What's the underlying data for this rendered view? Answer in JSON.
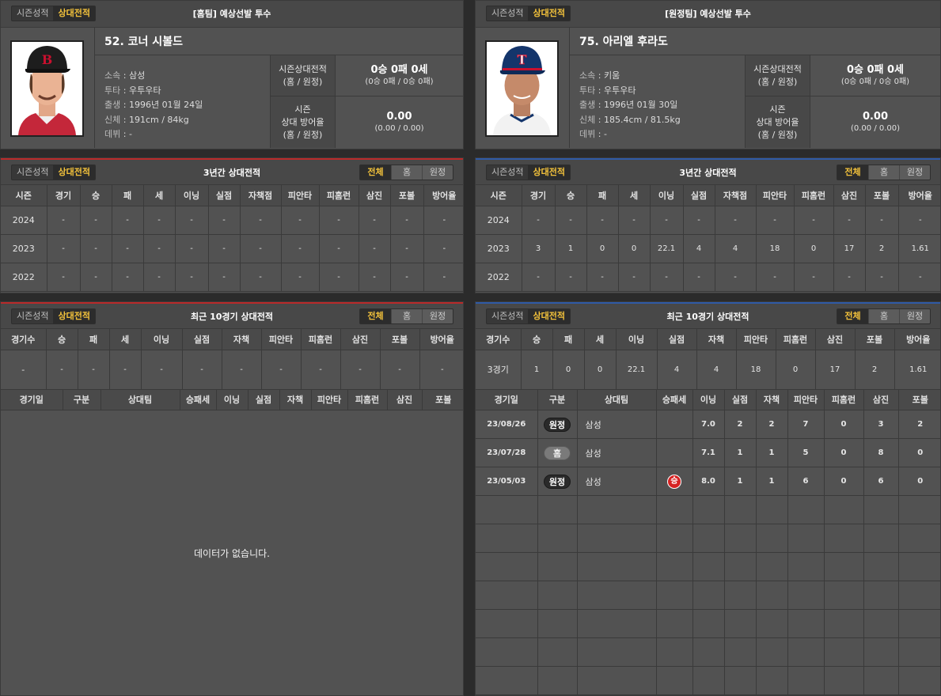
{
  "tabs": {
    "season": "시즌성적",
    "versus": "상대전적"
  },
  "seg": {
    "all": "전체",
    "home": "홈",
    "away": "원정"
  },
  "home": {
    "header": "[홈팀] 예상선발 투수",
    "player": {
      "name": "52. 코너 시볼드",
      "team_label": "소속",
      "team": "삼성",
      "throw_label": "투타",
      "throw": "우투우타",
      "birth_label": "출생",
      "birth": "1996년 01월 24일",
      "body_label": "신체",
      "body": "191cm / 84kg",
      "debut_label": "데뷔",
      "debut": "-",
      "cap_logo": "B",
      "cap_color": "#1d1d1d",
      "logo_color": "#c8102e"
    },
    "versus_label": "시즌상대전적",
    "versus_sub": "(홈 / 원정)",
    "versus_value": "0승 0패 0세",
    "versus_detail": "(0승 0패 / 0승 0패)",
    "era_label1": "시즌",
    "era_label2": "상대 방어율",
    "era_sub": "(홈 / 원정)",
    "era_value": "0.00",
    "era_detail": "(0.00 / 0.00)",
    "three_year": {
      "title": "3년간 상대전적",
      "columns": [
        "시즌",
        "경기",
        "승",
        "패",
        "세",
        "이닝",
        "실점",
        "자책점",
        "피안타",
        "피홈런",
        "삼진",
        "포볼",
        "방어율"
      ],
      "rows": [
        [
          "2024",
          "-",
          "-",
          "-",
          "-",
          "-",
          "-",
          "-",
          "-",
          "-",
          "-",
          "-",
          "-"
        ],
        [
          "2023",
          "-",
          "-",
          "-",
          "-",
          "-",
          "-",
          "-",
          "-",
          "-",
          "-",
          "-",
          "-"
        ],
        [
          "2022",
          "-",
          "-",
          "-",
          "-",
          "-",
          "-",
          "-",
          "-",
          "-",
          "-",
          "-",
          "-"
        ]
      ]
    },
    "recent": {
      "title": "최근 10경기 상대전적",
      "sum_columns": [
        "경기수",
        "승",
        "패",
        "세",
        "이닝",
        "실점",
        "자책",
        "피안타",
        "피홈런",
        "삼진",
        "포볼",
        "방어율"
      ],
      "sum_row": [
        "-",
        "-",
        "-",
        "-",
        "-",
        "-",
        "-",
        "-",
        "-",
        "-",
        "-",
        "-"
      ],
      "game_columns": [
        "경기일",
        "구분",
        "상대팀",
        "승패세",
        "이닝",
        "실점",
        "자책",
        "피안타",
        "피홈런",
        "삼진",
        "포볼"
      ],
      "empty": "데이터가 없습니다."
    }
  },
  "away": {
    "header": "[원정팀] 예상선발 투수",
    "player": {
      "name": "75. 아리엘 후라도",
      "team_label": "소속",
      "team": "키움",
      "throw_label": "투타",
      "throw": "우투우타",
      "birth_label": "출생",
      "birth": "1996년 01월 30일",
      "body_label": "신체",
      "body": "185.4cm / 81.5kg",
      "debut_label": "데뷔",
      "debut": "-",
      "cap_logo": "T",
      "cap_color": "#14356b",
      "logo_color": "#c8102e"
    },
    "versus_label": "시즌상대전적",
    "versus_sub": "(홈 / 원정)",
    "versus_value": "0승 0패 0세",
    "versus_detail": "(0승 0패 / 0승 0패)",
    "era_label1": "시즌",
    "era_label2": "상대 방어율",
    "era_sub": "(홈 / 원정)",
    "era_value": "0.00",
    "era_detail": "(0.00 / 0.00)",
    "three_year": {
      "title": "3년간 상대전적",
      "columns": [
        "시즌",
        "경기",
        "승",
        "패",
        "세",
        "이닝",
        "실점",
        "자책점",
        "피안타",
        "피홈런",
        "삼진",
        "포볼",
        "방어율"
      ],
      "rows": [
        [
          "2024",
          "-",
          "-",
          "-",
          "-",
          "-",
          "-",
          "-",
          "-",
          "-",
          "-",
          "-",
          "-"
        ],
        [
          "2023",
          "3",
          "1",
          "0",
          "0",
          "22.1",
          "4",
          "4",
          "18",
          "0",
          "17",
          "2",
          "1.61"
        ],
        [
          "2022",
          "-",
          "-",
          "-",
          "-",
          "-",
          "-",
          "-",
          "-",
          "-",
          "-",
          "-",
          "-"
        ]
      ]
    },
    "recent": {
      "title": "최근 10경기 상대전적",
      "sum_columns": [
        "경기수",
        "승",
        "패",
        "세",
        "이닝",
        "실점",
        "자책",
        "피안타",
        "피홈런",
        "삼진",
        "포볼",
        "방어율"
      ],
      "sum_row": [
        "3경기",
        "1",
        "0",
        "0",
        "22.1",
        "4",
        "4",
        "18",
        "0",
        "17",
        "2",
        "1.61"
      ],
      "game_columns": [
        "경기일",
        "구분",
        "상대팀",
        "승패세",
        "이닝",
        "실점",
        "자책",
        "피안타",
        "피홈런",
        "삼진",
        "포볼"
      ],
      "games": [
        {
          "date": "23/08/26",
          "type": "원정",
          "type_kind": "away",
          "opp": "삼성",
          "result": "",
          "ip": "7.0",
          "r": "2",
          "er": "2",
          "h": "7",
          "hr": "0",
          "so": "3",
          "bb": "2"
        },
        {
          "date": "23/07/28",
          "type": "홈",
          "type_kind": "home",
          "opp": "삼성",
          "result": "",
          "ip": "7.1",
          "r": "1",
          "er": "1",
          "h": "5",
          "hr": "0",
          "so": "8",
          "bb": "0"
        },
        {
          "date": "23/05/03",
          "type": "원정",
          "type_kind": "away",
          "opp": "삼성",
          "result": "승",
          "ip": "8.0",
          "r": "1",
          "er": "1",
          "h": "6",
          "hr": "0",
          "so": "6",
          "bb": "0"
        }
      ]
    }
  }
}
